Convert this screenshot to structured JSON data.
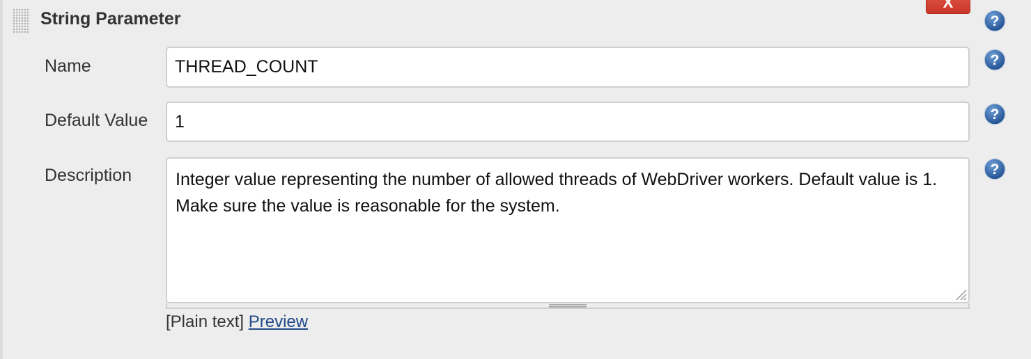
{
  "section": {
    "title": "String Parameter",
    "delete_label": "X"
  },
  "fields": {
    "name": {
      "label": "Name",
      "value": "THREAD_COUNT"
    },
    "default_value": {
      "label": "Default Value",
      "value": "1"
    },
    "description": {
      "label": "Description",
      "value": "Integer value representing the number of allowed threads of WebDriver workers. Default value is 1. Make sure the value is reasonable for the system."
    }
  },
  "format": {
    "mode_label": "[Plain text]",
    "preview_label": "Preview"
  },
  "icons": {
    "help": "help-icon",
    "drag": "drag-handle-icon",
    "resize": "resize-grip-icon"
  },
  "colors": {
    "background": "#ededed",
    "delete_button": "#d24637",
    "help_icon": "#2a5d9f",
    "link": "#204a87"
  }
}
